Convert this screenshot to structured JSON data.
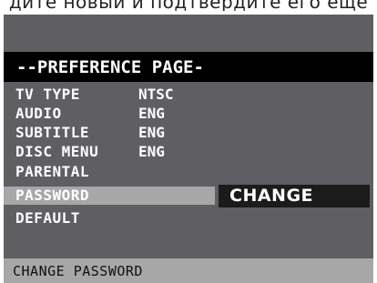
{
  "caption": "дите новый и подтвердите его еще",
  "menu": {
    "title": "--PREFERENCE PAGE-",
    "items": [
      {
        "label": "TV TYPE",
        "value": "NTSC"
      },
      {
        "label": "AUDIO",
        "value": "ENG"
      },
      {
        "label": "SUBTITLE",
        "value": "ENG"
      },
      {
        "label": "DISC MENU",
        "value": "ENG"
      },
      {
        "label": "PARENTAL",
        "value": ""
      },
      {
        "label": "PASSWORD",
        "value": ""
      },
      {
        "label": "DEFAULT",
        "value": ""
      }
    ],
    "selected_item": "PASSWORD",
    "submenu_option": "CHANGE"
  },
  "status_bar": {
    "text": "CHANGE PASSWORD"
  },
  "colors": {
    "screen_bg": "#5f5f63",
    "title_bg": "#000000",
    "highlight": "#a7a7a7",
    "submenu_bg": "#1b1b1b"
  }
}
